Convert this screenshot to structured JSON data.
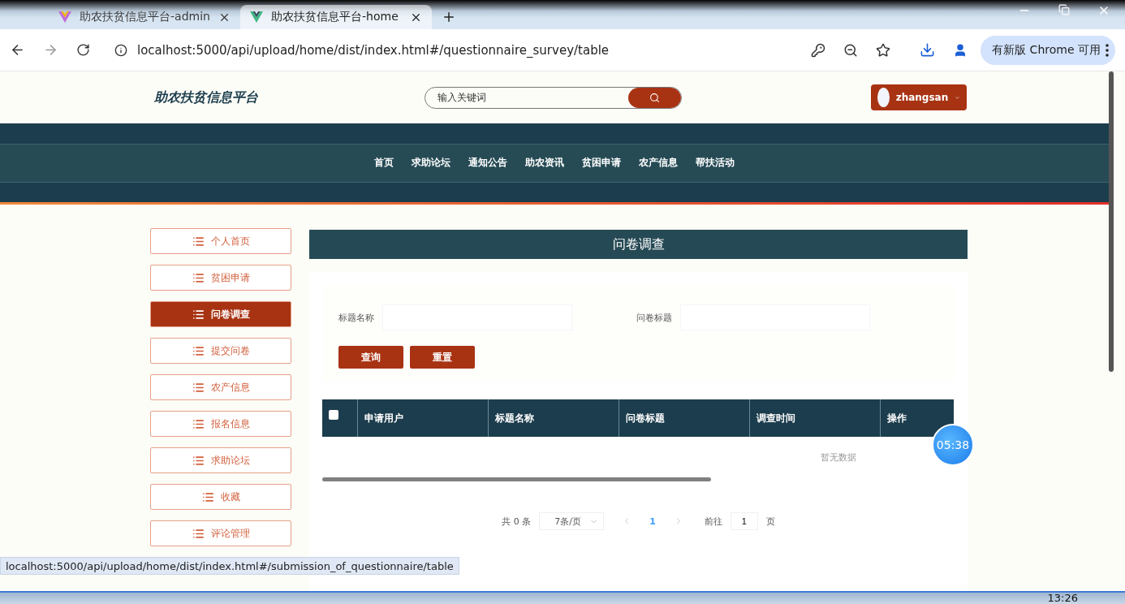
{
  "browser": {
    "tabs": [
      {
        "title": "助农扶贫信息平台-admin",
        "selected": false
      },
      {
        "title": "助农扶贫信息平台-home",
        "selected": true
      }
    ],
    "url": "localhost:5000/api/upload/home/dist/index.html#/questionnaire_survey/table",
    "update_button": "有新版 Chrome 可用",
    "status_url": "localhost:5000/api/upload/home/dist/index.html#/submission_of_questionnaire/table"
  },
  "header": {
    "site_title": "助农扶贫信息平台",
    "search_placeholder": "输入关键词",
    "user": "zhangsan"
  },
  "nav": [
    "首页",
    "求助论坛",
    "通知公告",
    "助农资讯",
    "贫困申请",
    "农产信息",
    "帮扶活动"
  ],
  "sidebar": [
    {
      "label": "个人首页",
      "selected": false
    },
    {
      "label": "贫困申请",
      "selected": false
    },
    {
      "label": "问卷调查",
      "selected": true
    },
    {
      "label": "提交问卷",
      "selected": false
    },
    {
      "label": "农产信息",
      "selected": false
    },
    {
      "label": "报名信息",
      "selected": false
    },
    {
      "label": "求助论坛",
      "selected": false
    },
    {
      "label": "收藏",
      "selected": false
    },
    {
      "label": "评论管理",
      "selected": false
    }
  ],
  "page_title": "问卷调查",
  "filters": [
    {
      "label": "标题名称"
    },
    {
      "label": "问卷标题"
    }
  ],
  "buttons": [
    "查询",
    "重置"
  ],
  "table": {
    "select_all_checked": false,
    "columns": [
      "申请用户",
      "标题名称",
      "问卷标题",
      "调查时间",
      "操作"
    ],
    "empty_text": "暂无数据"
  },
  "pagination": {
    "total": "共 0 条",
    "page_size": "7条/页",
    "current_page": "1",
    "goto_label": "前往",
    "goto_value": "1",
    "page_suffix": "页"
  },
  "recording_timer": "05:38",
  "taskbar_clock": "13:26"
}
